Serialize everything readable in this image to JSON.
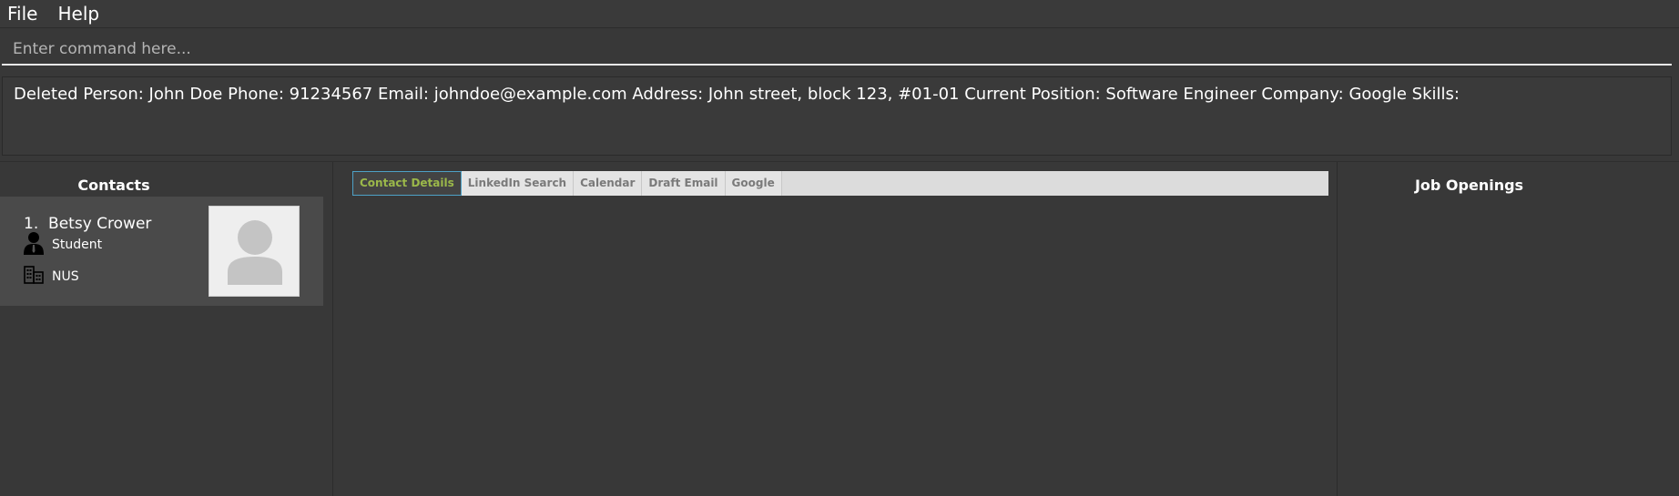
{
  "menu": {
    "file_label": "File",
    "help_label": "Help"
  },
  "command": {
    "placeholder": "Enter command here...",
    "value": ""
  },
  "result": {
    "text": "Deleted Person: John Doe Phone: 91234567 Email: johndoe@example.com Address: John street, block 123, #01-01 Current Position: Software Engineer Company: Google Skills:"
  },
  "contacts": {
    "title": "Contacts",
    "items": [
      {
        "index": "1.",
        "name": "Betsy Crower",
        "position": "Student",
        "company": "NUS",
        "position_icon": "person-icon",
        "company_icon": "building-icon",
        "avatar_icon": "avatar-placeholder-icon"
      }
    ]
  },
  "tabs": [
    {
      "label": "Contact Details",
      "active": true
    },
    {
      "label": "LinkedIn Search",
      "active": false
    },
    {
      "label": "Calendar",
      "active": false
    },
    {
      "label": "Draft Email",
      "active": false
    },
    {
      "label": "Google",
      "active": false
    }
  ],
  "jobs": {
    "title": "Job Openings"
  },
  "colors": {
    "background": "#383838",
    "active_tab_text": "#9bb84a",
    "active_tab_border": "#4ea1c6",
    "tab_text": "#7a7a7a",
    "tabbar_background": "#dcdcdc"
  }
}
